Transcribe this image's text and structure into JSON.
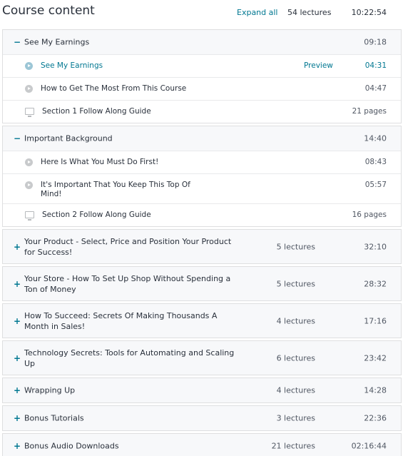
{
  "header": {
    "title": "Course content",
    "expand_all": "Expand all",
    "lectures": "54 lectures",
    "duration": "10:22:54"
  },
  "sections": [
    {
      "title": "See My Earnings",
      "toggle": "−",
      "duration": "09:18",
      "expanded": true,
      "lectures": [
        {
          "title": "See My Earnings",
          "preview": "Preview",
          "duration": "04:31",
          "icon": "play-icon"
        },
        {
          "title": "How to Get The Most From This Course",
          "duration": "04:47",
          "icon": "play-icon"
        },
        {
          "title": "Section 1 Follow Along Guide",
          "duration": "21 pages",
          "icon": "document-icon"
        }
      ]
    },
    {
      "title": "Important Background",
      "toggle": "−",
      "duration": "14:40",
      "expanded": true,
      "lectures": [
        {
          "title": "Here Is What You Must Do First!",
          "duration": "08:43",
          "icon": "play-icon"
        },
        {
          "title": "It's Important That You Keep This Top Of Mind!",
          "duration": "05:57",
          "icon": "play-icon"
        },
        {
          "title": "Section 2 Follow Along Guide",
          "duration": "16 pages",
          "icon": "document-icon"
        }
      ]
    },
    {
      "title": "Your Product - Select, Price and Position Your Product for Success!",
      "toggle": "+",
      "lectures_count": "5 lectures",
      "duration": "32:10",
      "expanded": false
    },
    {
      "title": "Your Store - How To Set Up Shop Without Spending a Ton of Money",
      "toggle": "+",
      "lectures_count": "5 lectures",
      "duration": "28:32",
      "expanded": false
    },
    {
      "title": "How To Succeed: Secrets Of Making Thousands A Month in Sales!",
      "toggle": "+",
      "lectures_count": "4 lectures",
      "duration": "17:16",
      "expanded": false
    },
    {
      "title": "Technology Secrets: Tools for Automating and Scaling Up",
      "toggle": "+",
      "lectures_count": "6 lectures",
      "duration": "23:42",
      "expanded": false
    },
    {
      "title": "Wrapping Up",
      "toggle": "+",
      "lectures_count": "4 lectures",
      "duration": "14:28",
      "expanded": false
    },
    {
      "title": "Bonus Tutorials",
      "toggle": "+",
      "lectures_count": "3 lectures",
      "duration": "22:36",
      "expanded": false
    },
    {
      "title": "Bonus Audio Downloads",
      "toggle": "+",
      "lectures_count": "21 lectures",
      "duration": "02:16:44",
      "expanded": false
    }
  ]
}
